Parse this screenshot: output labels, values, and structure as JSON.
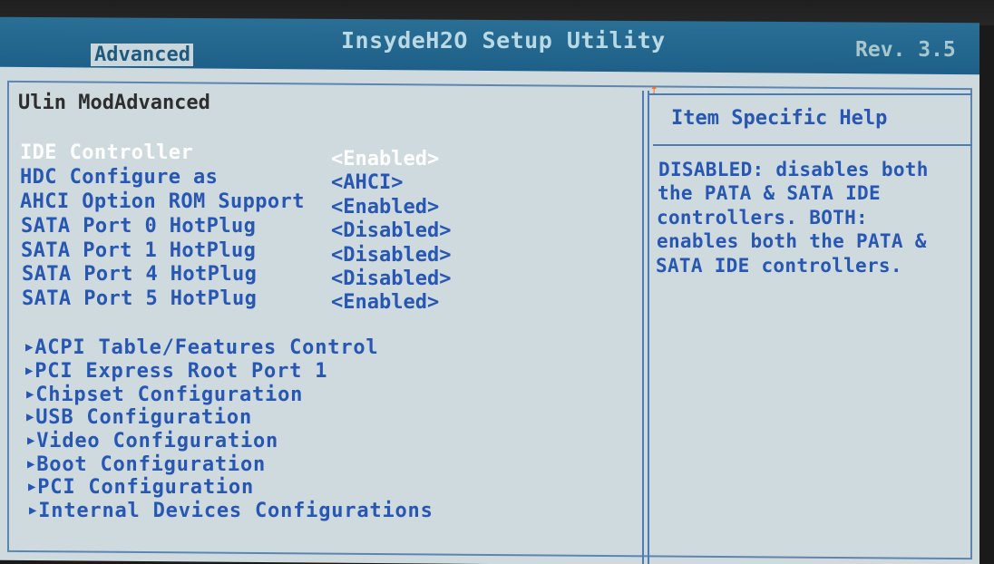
{
  "header": {
    "title": "InsydeH2O Setup Utility",
    "revision": "Rev. 3.5",
    "active_tab": "Advanced"
  },
  "main": {
    "screen_name": "Ulin ModAdvanced",
    "settings": [
      {
        "label": "IDE Controller",
        "value": "<Enabled>",
        "selected": true
      },
      {
        "label": "HDC Configure as",
        "value": "<AHCI>"
      },
      {
        "label": "AHCI Option ROM Support",
        "value": "<Enabled>"
      },
      {
        "label": "SATA Port 0 HotPlug",
        "value": "<Disabled>"
      },
      {
        "label": "SATA Port 1 HotPlug",
        "value": "<Disabled>"
      },
      {
        "label": "SATA Port 4 HotPlug",
        "value": "<Disabled>"
      },
      {
        "label": "SATA Port 5 HotPlug",
        "value": "<Enabled>"
      }
    ],
    "submenus": [
      "ACPI Table/Features Control",
      "PCI Express Root Port 1",
      "Chipset Configuration",
      "USB Configuration",
      "Video Configuration",
      "Boot Configuration",
      "PCI Configuration",
      "Internal Devices Configurations"
    ]
  },
  "help": {
    "title": "Item Specific Help",
    "lines": [
      "DISABLED: disables both",
      "the PATA & SATA IDE",
      "controllers. BOTH:",
      "enables both the PATA &",
      "SATA IDE controllers."
    ]
  },
  "colors": {
    "header_bar": "#1d5f88",
    "panel_background": "#cfdadf",
    "text_blue": "#2757b3",
    "selected_text": "#ffffff",
    "frame_line": "#4d7bb3",
    "scroll_indicator": "#ff6a16"
  },
  "icons": {
    "submenu_marker": "triangle-right-icon",
    "scroll_indicator": "scroll-up-arrow-icon"
  }
}
